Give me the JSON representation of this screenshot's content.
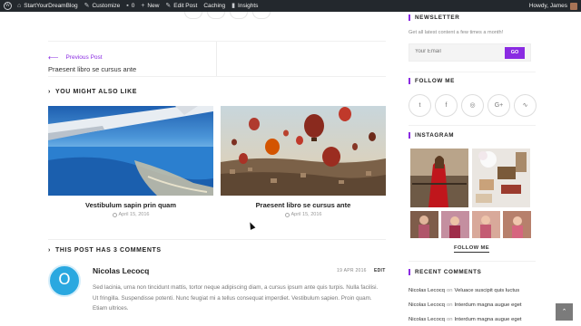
{
  "adminbar": {
    "site_name": "StartYourDreamBlog",
    "customize": "Customize",
    "comments_count": "0",
    "new_label": "New",
    "edit_post": "Edit Post",
    "caching": "Caching",
    "insights": "Insights",
    "greeting": "Howdy, James"
  },
  "post_nav": {
    "prev_label": "Previous Post",
    "prev_title": "Praesent libro se cursus ante"
  },
  "related": {
    "heading": "YOU MIGHT ALSO LIKE",
    "items": [
      {
        "title": "Vestibulum sapin prin quam",
        "date": "April 15, 2016"
      },
      {
        "title": "Praesent libro se cursus ante",
        "date": "April 15, 2016"
      }
    ]
  },
  "comments": {
    "heading": "THIS POST HAS 3 COMMENTS",
    "items": [
      {
        "avatar_letter": "O",
        "author": "Nicolas Lecocq",
        "date": "19 APR 2016",
        "edit": "EDIT",
        "text": "Sed lacinia, urna non tincidunt mattis, tortor neque adipiscing diam, a cursus ipsum ante quis turpis. Nulla facilisi. Ut fringilla. Suspendisse potenti. Nunc feugiat mi a tellus consequat imperdiet. Vestibulum sapien. Proin quam. Etiam ultrices."
      }
    ]
  },
  "sidebar": {
    "newsletter": {
      "title": "NEWSLETTER",
      "text": "Get all latest content a few times a month!",
      "placeholder": "Your Email",
      "button": "GO"
    },
    "follow": {
      "title": "FOLLOW ME",
      "icons": [
        "twitter-icon",
        "facebook-icon",
        "instagram-icon",
        "google-plus-icon",
        "rss-icon"
      ]
    },
    "instagram": {
      "title": "INSTAGRAM",
      "follow_label": "FOLLOW ME"
    },
    "recent_comments": {
      "title": "RECENT COMMENTS",
      "items": [
        {
          "author": "Nicolas Lecocq",
          "on": "on",
          "post": "Veluace suscipit quis luctus"
        },
        {
          "author": "Nicolas Lecocq",
          "on": "on",
          "post": "Interdum magna augue eget"
        },
        {
          "author": "Nicolas Lecocq",
          "on": "on",
          "post": "Interdum magna augue eget"
        }
      ]
    }
  },
  "colors": {
    "accent": "#8a2be2",
    "adminbar_bg": "#23282d",
    "avatar_blue": "#2aa8e0"
  }
}
